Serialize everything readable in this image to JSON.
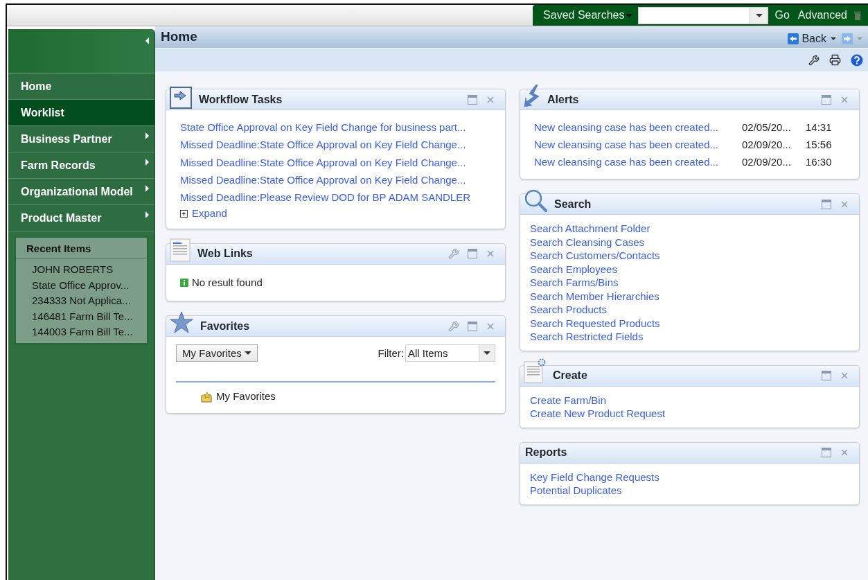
{
  "top_bar": {
    "saved_searches": "Saved Searches",
    "go": "Go",
    "advanced": "Advanced"
  },
  "page_title": "Home",
  "back": "Back",
  "nav": [
    {
      "label": "Home",
      "selected": false,
      "submenu": false
    },
    {
      "label": "Worklist",
      "selected": true,
      "submenu": false
    },
    {
      "label": "Business Partner",
      "selected": false,
      "submenu": true
    },
    {
      "label": "Farm Records",
      "selected": false,
      "submenu": true
    },
    {
      "label": "Organizational Model",
      "selected": false,
      "submenu": true
    },
    {
      "label": "Product Master",
      "selected": false,
      "submenu": true
    }
  ],
  "recent_items": {
    "title": "Recent Items",
    "items": [
      "JOHN ROBERTS",
      "State Office Approv...",
      "234333 Not Applica...",
      "146481 Farm Bill Te...",
      "144003 Farm Bill Te..."
    ]
  },
  "columns": [
    [
      {
        "kind": "tasks",
        "title": "Workflow Tasks",
        "settings": false,
        "links": [
          "State Office Approval on Key Field Change for business part...",
          "Missed Deadline:State Office Approval on Key Field Change...",
          "Missed Deadline:State Office Approval on Key Field Change...",
          "Missed Deadline:State Office Approval on Key Field Change...",
          "Missed Deadline:Please Review DOD for BP ADAM SANDLER"
        ],
        "expand": "Expand"
      },
      {
        "kind": "message",
        "title": "Web Links",
        "settings": true,
        "message": "No result found"
      },
      {
        "kind": "favorites",
        "title": "Favorites",
        "settings": true,
        "menu": "My Favorites",
        "filter_label": "Filter:",
        "filter_value": "All Items",
        "folder": "My Favorites"
      }
    ],
    [
      {
        "kind": "alerts",
        "title": "Alerts",
        "settings": false,
        "rows": [
          {
            "text": "New cleansing case has been created...",
            "date": "02/05/20...",
            "time": "14:31"
          },
          {
            "text": "New cleansing case has been created...",
            "date": "02/09/20...",
            "time": "15:56"
          },
          {
            "text": "New cleansing case has been created...",
            "date": "02/09/20...",
            "time": "16:30"
          }
        ]
      },
      {
        "kind": "links",
        "title": "Search",
        "settings": false,
        "links": [
          "Search Attachment Folder",
          "Search Cleansing Cases",
          "Search Customers/Contacts",
          "Search Employees",
          "Search Farms/Bins",
          "Search Member Hierarchies",
          "Search Products",
          "Search Requested Products",
          "Search Restricted Fields"
        ]
      },
      {
        "kind": "links",
        "title": "Create",
        "settings": false,
        "links": [
          "Create Farm/Bin",
          "Create New Product Request"
        ]
      },
      {
        "kind": "links",
        "title": "Reports",
        "settings": false,
        "links": [
          "Key Field Change Requests",
          "Potential Duplicates"
        ]
      }
    ]
  ]
}
